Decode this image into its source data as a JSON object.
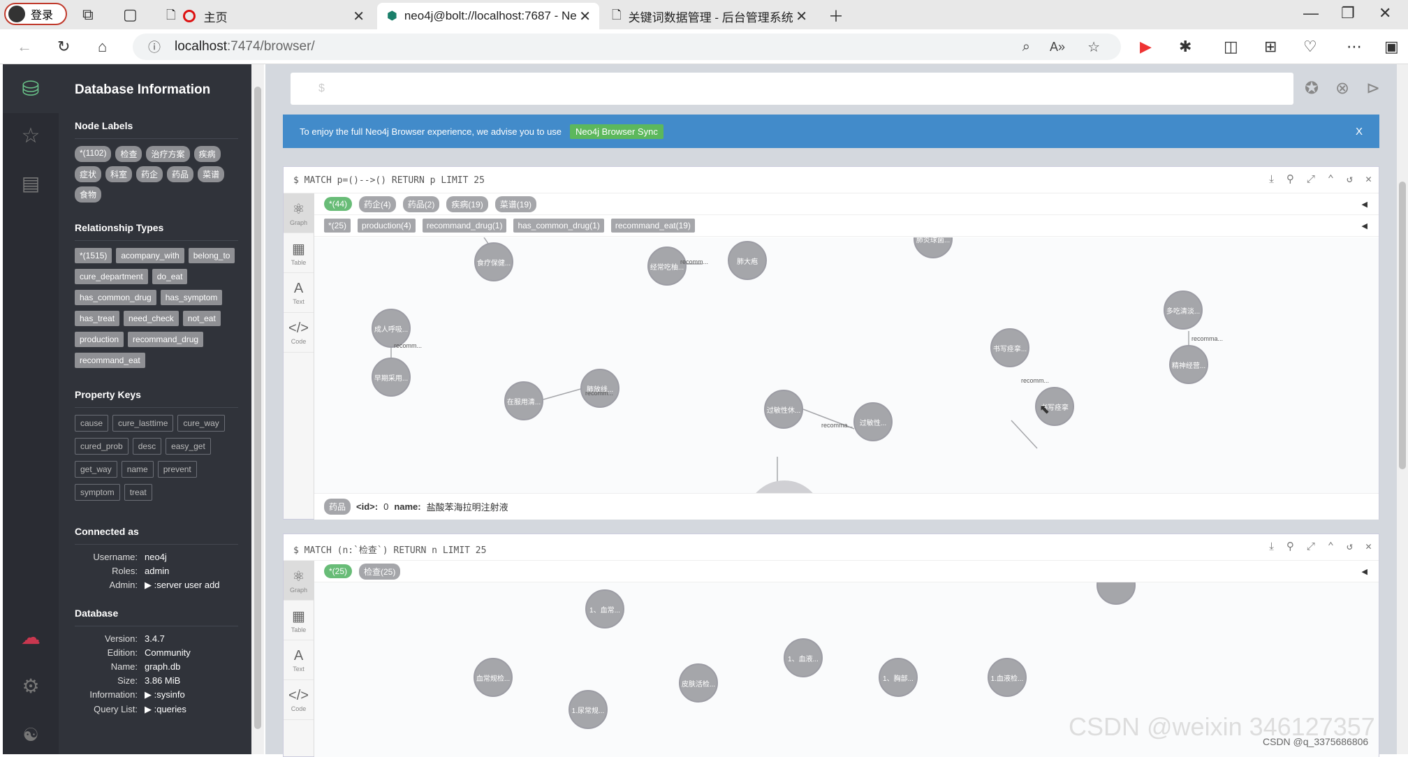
{
  "browser": {
    "login_label": "登录",
    "tabs": [
      {
        "title": "主页"
      },
      {
        "title": "neo4j@bolt://localhost:7687 - Ne"
      },
      {
        "title": "关键词数据管理 - 后台管理系统"
      }
    ],
    "url_host": "localhost",
    "url_rest": ":7474/browser/"
  },
  "sidebar": {
    "title": "Database Information",
    "node_labels_title": "Node Labels",
    "node_labels": [
      "*(1102)",
      "检查",
      "治疗方案",
      "疾病",
      "症状",
      "科室",
      "药企",
      "药品",
      "菜谱",
      "食物"
    ],
    "relationship_types_title": "Relationship Types",
    "relationship_types": [
      "*(1515)",
      "acompany_with",
      "belong_to",
      "cure_department",
      "do_eat",
      "has_common_drug",
      "has_symptom",
      "has_treat",
      "need_check",
      "not_eat",
      "production",
      "recommand_drug",
      "recommand_eat"
    ],
    "property_keys_title": "Property Keys",
    "property_keys": [
      "cause",
      "cure_lasttime",
      "cure_way",
      "cured_prob",
      "desc",
      "easy_get",
      "get_way",
      "name",
      "prevent",
      "symptom",
      "treat"
    ],
    "connected_title": "Connected as",
    "username_label": "Username:",
    "username": "neo4j",
    "roles_label": "Roles:",
    "roles": "admin",
    "admin_label": "Admin:",
    "admin": ":server user add",
    "database_title": "Database",
    "version_label": "Version:",
    "version": "3.4.7",
    "edition_label": "Edition:",
    "edition": "Community",
    "name_label": "Name:",
    "name": "graph.db",
    "size_label": "Size:",
    "size": "3.86 MiB",
    "information_label": "Information:",
    "information": ":sysinfo",
    "query_label": "Query List:",
    "query": ":queries"
  },
  "editor": {
    "prompt": "$"
  },
  "banner": {
    "text": "To enjoy the full Neo4j Browser experience, we advise you to use",
    "sync_label": "Neo4j Browser Sync",
    "close": "X"
  },
  "frame1": {
    "query": "$ MATCH p=()-->() RETURN p LIMIT 25",
    "node_labels": [
      "*(44)",
      "药企(4)",
      "药品(2)",
      "疾病(19)",
      "菜谱(19)"
    ],
    "rel_labels": [
      "*(25)",
      "production(4)",
      "recommand_drug(1)",
      "has_common_drug(1)",
      "recommand_eat(19)"
    ],
    "nodes": [
      "食疗保健...",
      "经常吃柚...",
      "肺大疱",
      "肺炎球菌...",
      "成人呼吸...",
      "早期采用...",
      "在服用清...",
      "肺放线...",
      "过敏性休...",
      "过敏性...",
      "书写痉挛...",
      "书写痉挛",
      "多吃清淡...",
      "精神经营..."
    ],
    "rels": [
      "recomm...",
      "recomm...",
      "recomm...",
      "recomma...",
      "recomm...",
      "recomma..."
    ],
    "status_label": "药品",
    "status_id_label": "<id>:",
    "status_id": "0",
    "status_name_label": "name:",
    "status_name": "盐酸苯海拉明注射液"
  },
  "frame2": {
    "query": "$ MATCH (n:`检查`) RETURN n LIMIT 25",
    "node_labels": [
      "*(25)",
      "检查(25)"
    ],
    "nodes": [
      "1、血常...",
      "1、血液...",
      "血常规检...",
      "皮肤活检...",
      "1、胸部...",
      "1.血液检...",
      "1.尿常规..."
    ]
  },
  "side_tabs": [
    "Graph",
    "Table",
    "Text",
    "Code"
  ],
  "watermark": "CSDN @weixin 346127357",
  "watermark2": "CSDN @q_3375686806"
}
